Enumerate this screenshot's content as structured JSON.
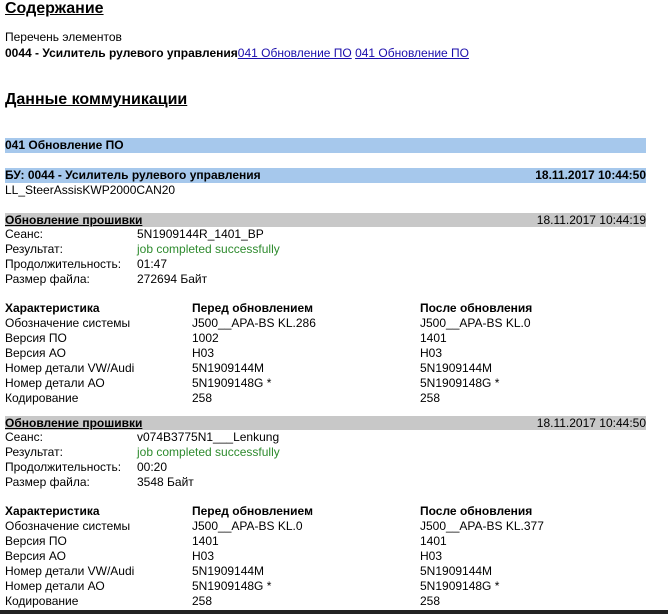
{
  "toc": {
    "title": "Содержание",
    "subtitle": "Перечень элементов",
    "unit_label": "0044 - Усилитель рулевого управления",
    "links": [
      "041 Обновление ПО",
      "041 Обновление ПО"
    ]
  },
  "comm": {
    "title": "Данные коммуникации",
    "section_band": "041 Обновление ПО",
    "unit": {
      "label": "БУ: 0044 - Усилитель рулевого управления",
      "date": "18.11.2017 10:44:50",
      "id": "LL_SteerAssisKWP2000CAN20"
    }
  },
  "labels": {
    "session": "Сеанс:",
    "result": "Результат:",
    "duration": "Продолжительность:",
    "filesize": "Размер файла:",
    "spec_header": [
      "Характеристика",
      "Перед обновлением",
      "После обновления"
    ]
  },
  "updates": [
    {
      "title": "Обновление прошивки",
      "date": "18.11.2017 10:44:19",
      "session": "5N1909144R_1401_BP",
      "result": "job completed successfully",
      "duration": "01:47",
      "filesize": "272694 Байт",
      "rows": [
        [
          "Обозначение системы",
          "J500__APA-BS KL.286",
          "J500__APA-BS KL.0"
        ],
        [
          "Версия ПО",
          "1002",
          "1401"
        ],
        [
          "Версия АО",
          "H03",
          "H03"
        ],
        [
          "Номер детали VW/Audi",
          "5N1909144M",
          "5N1909144M"
        ],
        [
          "Номер детали АО",
          "5N1909148G *",
          "5N1909148G *"
        ],
        [
          "Кодирование",
          "258",
          "258"
        ]
      ]
    },
    {
      "title": "Обновление прошивки",
      "date": "18.11.2017 10:44:50",
      "session": "v074B3775N1___Lenkung",
      "result": "job completed successfully",
      "duration": "00:20",
      "filesize": "3548 Байт",
      "rows": [
        [
          "Обозначение системы",
          "J500__APA-BS KL.0",
          "J500__APA-BS KL.377"
        ],
        [
          "Версия ПО",
          "1401",
          "1401"
        ],
        [
          "Версия АО",
          "H03",
          "H03"
        ],
        [
          "Номер детали VW/Audi",
          "5N1909144M",
          "5N1909144M"
        ],
        [
          "Номер детали АО",
          "5N1909148G *",
          "5N1909148G *"
        ],
        [
          "Кодирование",
          "258",
          "258"
        ]
      ]
    }
  ]
}
